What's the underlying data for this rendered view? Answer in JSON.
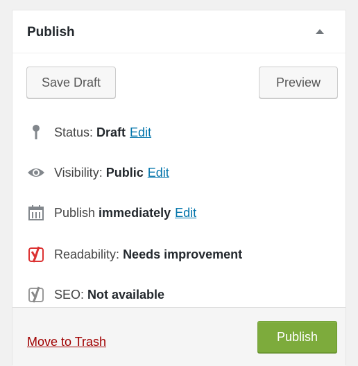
{
  "header": {
    "title": "Publish",
    "toggle_icon": "triangle-up-icon"
  },
  "buttons": {
    "save_draft": "Save Draft",
    "preview": "Preview",
    "publish": "Publish"
  },
  "status": {
    "icon": "pin-icon",
    "label": "Status:",
    "value": "Draft",
    "edit": "Edit"
  },
  "visibility": {
    "icon": "eye-icon",
    "label": "Visibility:",
    "value": "Public",
    "edit": "Edit"
  },
  "schedule": {
    "icon": "calendar-icon",
    "label": "Publish",
    "value": "immediately",
    "edit": "Edit"
  },
  "readability": {
    "icon": "yoast-icon",
    "icon_color": "#dc3232",
    "label": "Readability:",
    "value": "Needs improvement"
  },
  "seo": {
    "icon": "yoast-icon",
    "icon_color": "#888888",
    "label": "SEO:",
    "value": "Not available"
  },
  "footer": {
    "trash": "Move to Trash"
  },
  "colors": {
    "link": "#0073aa",
    "trash": "#a00000",
    "publish_bg": "#7dab3c"
  }
}
